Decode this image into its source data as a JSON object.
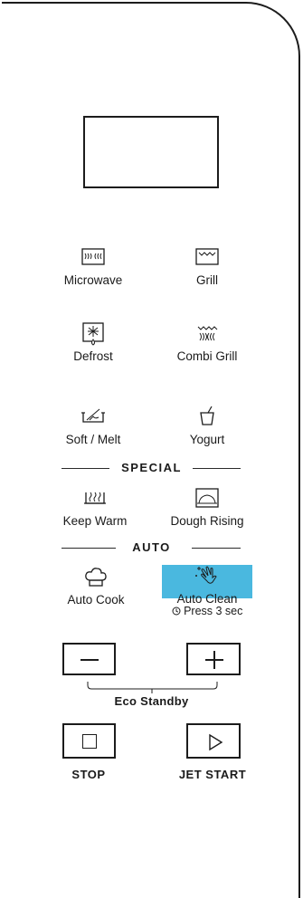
{
  "buttons": {
    "microwave": "Microwave",
    "grill": "Grill",
    "defrost": "Defrost",
    "combi_grill": "Combi Grill",
    "soft_melt": "Soft / Melt",
    "yogurt": "Yogurt",
    "keep_warm": "Keep Warm",
    "dough_rising": "Dough Rising",
    "auto_cook": "Auto Cook",
    "auto_clean": "Auto Clean",
    "auto_clean_hint": "Press 3 sec"
  },
  "sections": {
    "special": "SPECIAL",
    "auto": "AUTO"
  },
  "controls": {
    "minus_symbol": "−",
    "plus_symbol": "+",
    "eco_standby": "Eco Standby",
    "stop": "STOP",
    "jet_start": "JET START"
  },
  "colors": {
    "outline": "#1c1c1c",
    "highlight": "#4ab8df"
  },
  "icons": {
    "microwave": "microwave-waves-icon",
    "grill": "grill-icon",
    "defrost": "snowflake-defrost-icon",
    "combi_grill": "combi-grill-icon",
    "soft_melt": "soft-melt-icon",
    "yogurt": "yogurt-cup-icon",
    "keep_warm": "steam-warm-icon",
    "dough_rising": "dough-rising-icon",
    "auto_cook": "chef-hat-icon",
    "auto_clean": "clean-hand-sparkle-icon",
    "timer": "clock-icon",
    "stop": "stop-square-icon",
    "start": "play-triangle-icon"
  }
}
